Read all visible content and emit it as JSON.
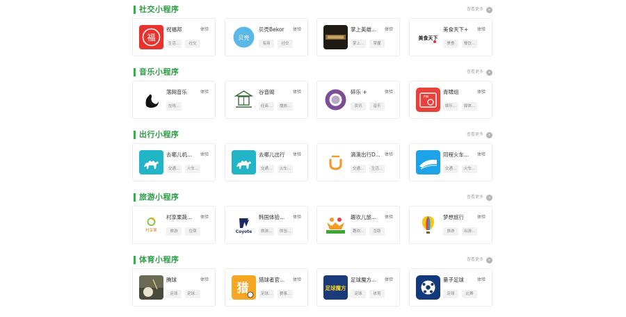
{
  "more_label": "查看更多",
  "sections": [
    {
      "title": "社交小程序",
      "apps": [
        {
          "name": "祝福邦",
          "try": "体验",
          "tags": [
            "生活...",
            "社交"
          ],
          "icon": "fu-blessing-logo"
        },
        {
          "name": "贝壳Bekor",
          "try": "体验",
          "tags": [
            "有商",
            "社交"
          ],
          "icon": "bekor-shell-logo"
        },
        {
          "name": "掌上英雄...",
          "try": "体验",
          "tags": [
            "掌上...",
            "掌握"
          ],
          "icon": "game-banner-logo"
        },
        {
          "name": "美食天下+",
          "try": "体验",
          "tags": [
            "美食",
            "餐饮..."
          ],
          "icon": "meishi-tianxia-logo"
        }
      ]
    },
    {
      "title": "音乐小程序",
      "apps": [
        {
          "name": "落网音乐",
          "try": "体验",
          "tags": [
            "在线..."
          ],
          "icon": "swan-logo"
        },
        {
          "name": "谷音阁",
          "try": "体验",
          "tags": [
            "经商...",
            "播放..."
          ],
          "icon": "pavilion-logo"
        },
        {
          "name": "碎乐 +",
          "try": "体验",
          "tags": [
            "资讯",
            "音乐"
          ],
          "icon": "suile-logo"
        },
        {
          "name": "青啸组",
          "try": "体验",
          "tags": [
            "娱乐...",
            "媒体..."
          ],
          "icon": "fm-radio-logo"
        }
      ]
    },
    {
      "title": "出行小程序",
      "apps": [
        {
          "name": "去哪儿机...",
          "try": "体验",
          "tags": [
            "交通...",
            "火车..."
          ],
          "icon": "qunar-camel-logo"
        },
        {
          "name": "去哪儿出行",
          "try": "体验",
          "tags": [
            "交通...",
            "火车..."
          ],
          "icon": "qunar-camel-logo"
        },
        {
          "name": "滴滴出行D...",
          "try": "体验",
          "tags": [
            "交通...",
            "生活..."
          ],
          "icon": "didi-logo"
        },
        {
          "name": "同程火车...",
          "try": "体验",
          "tags": [
            "交通...",
            "火车..."
          ],
          "icon": "train-logo"
        }
      ]
    },
    {
      "title": "旅游小程序",
      "apps": [
        {
          "name": "村享果蔬...",
          "try": "体验",
          "tags": [
            "旅游",
            "住宿"
          ],
          "icon": "cunxiang-logo"
        },
        {
          "name": "韩国体验...",
          "try": "体验",
          "tags": [
            "旅游...",
            "体验..."
          ],
          "icon": "coyote-logo"
        },
        {
          "name": "趣欢儿旅...",
          "try": "体验",
          "tags": [
            "趣欢...",
            "互助"
          ],
          "icon": "quhuan-logo"
        },
        {
          "name": "梦想旅行",
          "try": "体验",
          "tags": [
            "旅游",
            "出游..."
          ],
          "icon": "balloon-logo"
        }
      ]
    },
    {
      "title": "体育小程序",
      "apps": [
        {
          "name": "腾球",
          "try": "体验",
          "tags": [
            "足球",
            "足球..."
          ],
          "icon": "table-ball-logo"
        },
        {
          "name": "猎球者官...",
          "try": "体验",
          "tags": [
            "足球...",
            "赛事..."
          ],
          "icon": "lie-ball-logo"
        },
        {
          "name": "足球魔方...",
          "try": "体验",
          "tags": [
            "足球",
            "体育"
          ],
          "icon": "football-cube-logo"
        },
        {
          "name": "量子足球",
          "try": "体验",
          "tags": [
            "足球",
            "比赛"
          ],
          "icon": "quantum-football-logo"
        }
      ]
    }
  ],
  "logo_text": {
    "fu": "福",
    "bekor": "贝壳",
    "meishi": "美食天下",
    "cunxiang": "村享果",
    "coyote": "Coyote",
    "lie": "猎",
    "football_cube": "足球魔方",
    "fm": "FM"
  },
  "colors": {
    "accent_green": "#2db34a",
    "title_green": "#2b9e44",
    "card_border": "#ececec",
    "tag_bg": "#f2f2f2"
  }
}
